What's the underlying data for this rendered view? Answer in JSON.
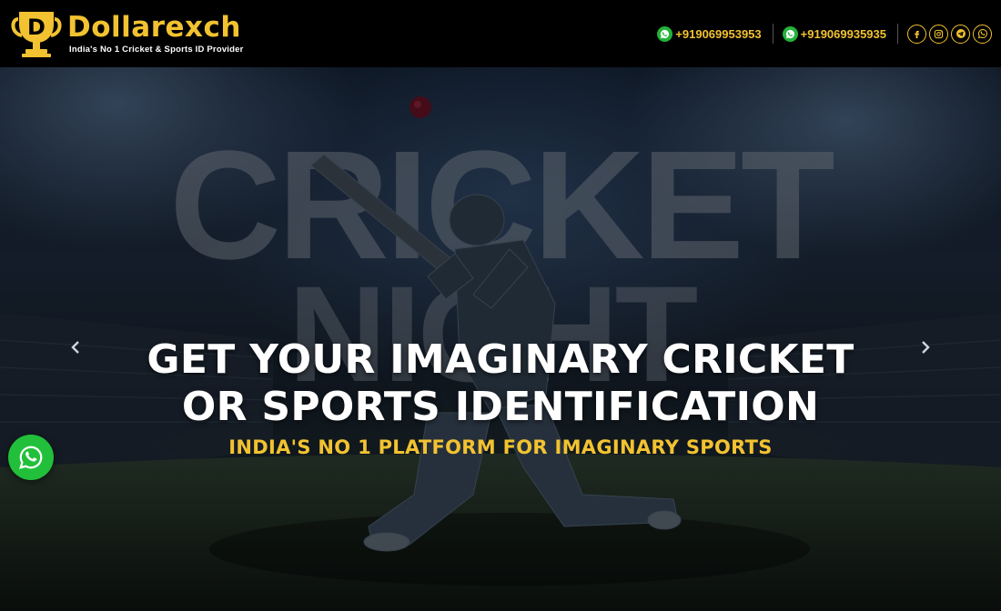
{
  "header": {
    "brand_name": "Dollarexch",
    "brand_tagline": "India's No 1 Cricket & Sports ID Provider",
    "logo_letter": "D",
    "phones": [
      "+919069953953",
      "+919069935935"
    ],
    "socials": [
      "facebook-icon",
      "instagram-icon",
      "telegram-icon",
      "whatsapp-icon"
    ]
  },
  "hero": {
    "title_line1": "GET YOUR IMAGINARY CRICKET",
    "title_line2": "OR SPORTS IDENTIFICATION",
    "subtitle": "INDIA'S NO 1 PLATFORM FOR IMAGINARY SPORTS",
    "background_text_line1": "CRICKET",
    "background_text_line2": "NIGHT"
  },
  "colors": {
    "accent": "#f2c230",
    "background": "#000000",
    "whatsapp": "#22c03a"
  }
}
